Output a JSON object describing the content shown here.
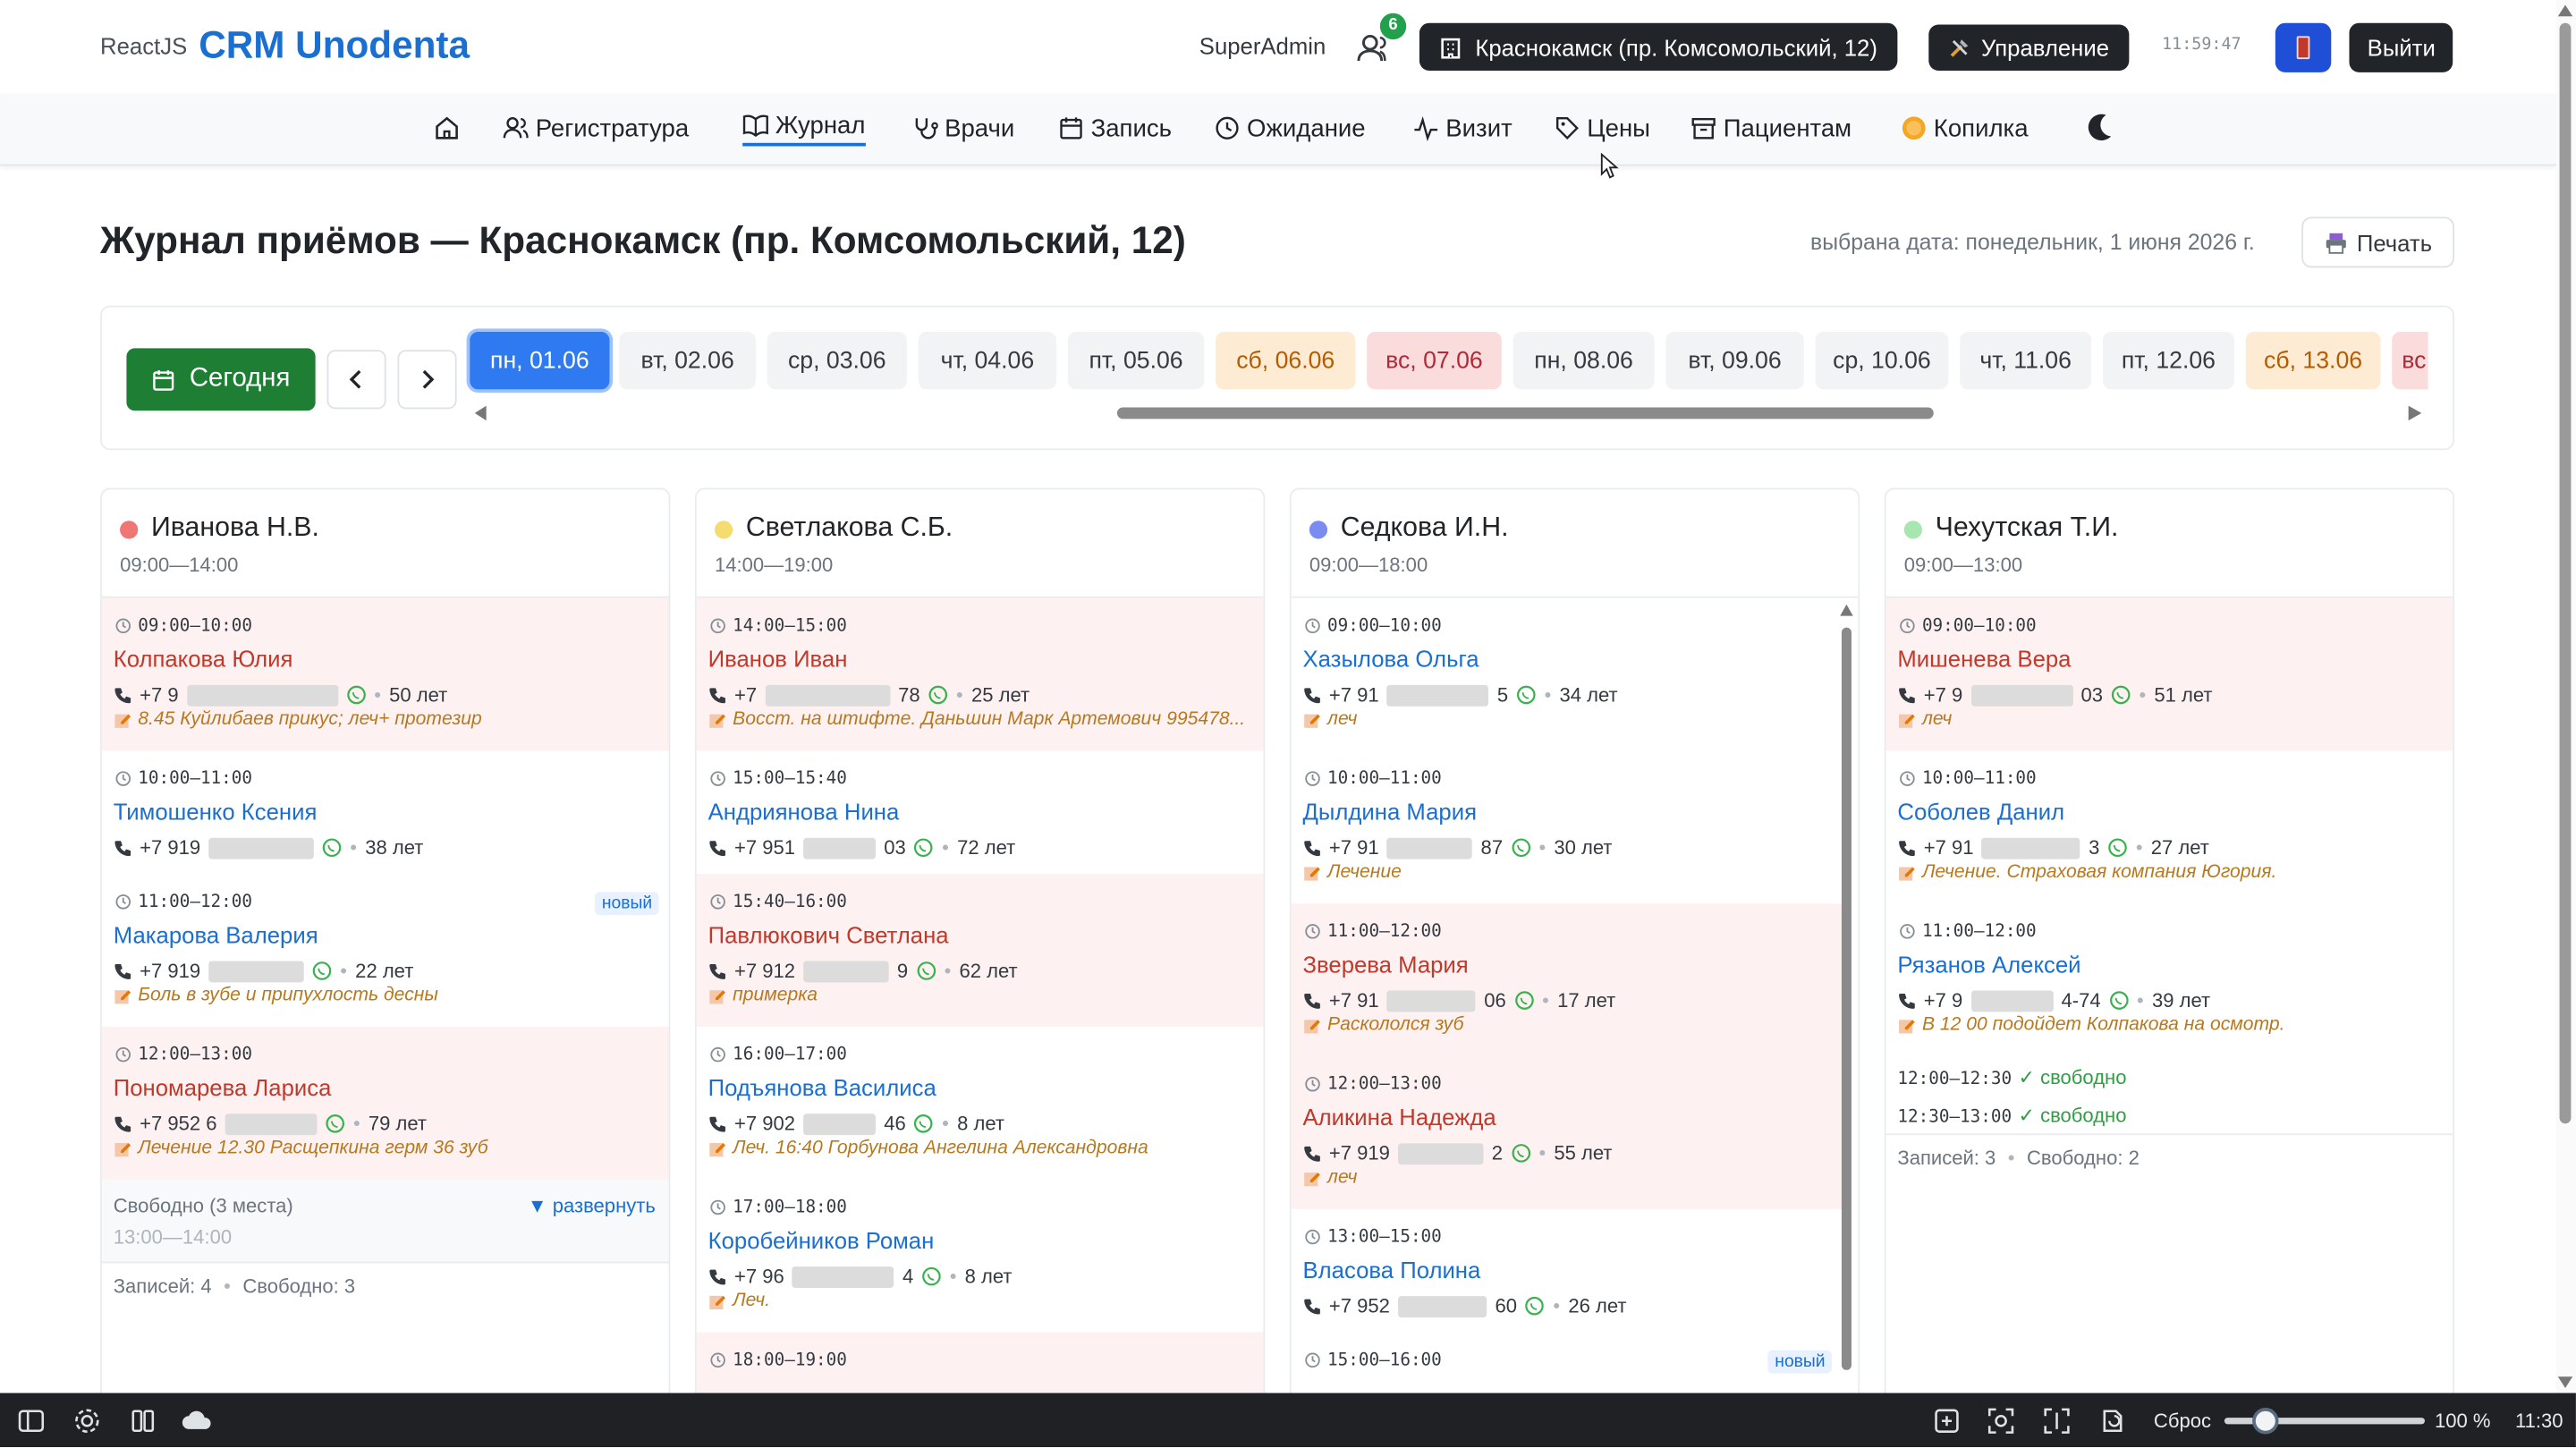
{
  "header": {
    "brand_small": "ReactJS",
    "brand_big": "CRM Unodenta",
    "user": "SuperAdmin",
    "users_count": "6",
    "branch_button": "Краснокамск (пр. Комсомольский, 12)",
    "manage_button": "Управление",
    "clock": "11:59:47",
    "logout_button": "Выйти"
  },
  "nav": {
    "registry": "Регистратура",
    "journal": "Журнал",
    "doctors": "Врачи",
    "record": "Запись",
    "waiting": "Ожидание",
    "visit": "Визит",
    "prices": "Цены",
    "patients": "Пациентам",
    "piggy": "Копилка"
  },
  "page": {
    "title": "Журнал приёмов — Краснокамск (пр. Комсомольский, 12)",
    "selected_date": "выбрана дата: понедельник, 1 июня 2026 г.",
    "print_button": "Печать"
  },
  "dates": {
    "today_button": "Сегодня",
    "days": [
      "пн, 01.06",
      "вт, 02.06",
      "ср, 03.06",
      "чт, 04.06",
      "пт, 05.06",
      "сб, 06.06",
      "вс, 07.06",
      "пн, 08.06",
      "вт, 09.06",
      "ср, 10.06",
      "чт, 11.06",
      "пт, 12.06",
      "сб, 13.06",
      "вс"
    ]
  },
  "columns": [
    {
      "doctor": "Иванова Н.В.",
      "hours": "09:00—14:00",
      "color": "#f07575",
      "appointments": [
        {
          "time": "09:00—10:00",
          "name": "Колпакова Юлия",
          "phone_pre": "+7 9",
          "phone_post": "",
          "age": "50 лет",
          "note": "8.45 Куйлибаев прикус; леч+ протезир"
        },
        {
          "time": "10:00—11:00",
          "name": "Тимошенко Ксения",
          "phone_pre": "+7 919",
          "phone_post": "",
          "age": "38 лет",
          "note": ""
        },
        {
          "time": "11:00—12:00",
          "name": "Макарова Валерия",
          "phone_pre": "+7 919",
          "phone_post": "",
          "age": "22 лет",
          "note": "Боль в зубе и припухлость десны",
          "badge": "новый"
        },
        {
          "time": "12:00—13:00",
          "name": "Пономарева Лариса",
          "phone_pre": "+7 952 6",
          "phone_post": "",
          "age": "79 лет",
          "note": "Лечение 12.30 Расщепкина герм 36 зуб"
        }
      ],
      "free_summary": "Свободно (3 места)",
      "free_range": "13:00—14:00",
      "expand": "▼ развернуть",
      "stat_records": "Записей: 4",
      "stat_free": "Свободно: 3"
    },
    {
      "doctor": "Светлакова С.Б.",
      "hours": "14:00—19:00",
      "color": "#f5dc6e",
      "appointments": [
        {
          "time": "14:00—15:00",
          "name": "Иванов Иван",
          "phone_pre": "+7",
          "phone_post": "78",
          "age": "25 лет",
          "note": "Восст. на штифте. Даньшин Марк Артемович 995478..."
        },
        {
          "time": "15:00—15:40",
          "name": "Андриянова Нина",
          "phone_pre": "+7 951",
          "phone_post": "03",
          "age": "72 лет",
          "note": ""
        },
        {
          "time": "15:40—16:00",
          "name": "Павлюкович Светлана",
          "phone_pre": "+7 912",
          "phone_post": "9",
          "age": "62 лет",
          "note": "примерка"
        },
        {
          "time": "16:00—17:00",
          "name": "Подъянова Василиса",
          "phone_pre": "+7 902",
          "phone_post": "46",
          "age": "8 лет",
          "note": "Леч. 16:40 Горбунова Ангелина Александровна"
        },
        {
          "time": "17:00—18:00",
          "name": "Коробейников Роман",
          "phone_pre": "+7 96",
          "phone_post": "4",
          "age": "8 лет",
          "note": "Леч."
        },
        {
          "time": "18:00—19:00"
        }
      ]
    },
    {
      "doctor": "Седкова И.Н.",
      "hours": "09:00—18:00",
      "color": "#7b8cf0",
      "appointments": [
        {
          "time": "09:00—10:00",
          "name": "Хазылова Ольга",
          "phone_pre": "+7 91",
          "phone_post": "5",
          "age": "34 лет",
          "note": "леч"
        },
        {
          "time": "10:00—11:00",
          "name": "Дылдина Мария",
          "phone_pre": "+7 91",
          "phone_post": "87",
          "age": "30 лет",
          "note": "Лечение"
        },
        {
          "time": "11:00—12:00",
          "name": "Зверева Мария",
          "phone_pre": "+7 91",
          "phone_post": "06",
          "age": "17 лет",
          "note": "Раскололся зуб"
        },
        {
          "time": "12:00—13:00",
          "name": "Аликина Надежда",
          "phone_pre": "+7 919",
          "phone_post": "2",
          "age": "55 лет",
          "note": "леч"
        },
        {
          "time": "13:00—15:00",
          "name": "Власова Полина",
          "phone_pre": "+7 952",
          "phone_post": "60",
          "age": "26 лет",
          "note": ""
        },
        {
          "time": "15:00—16:00",
          "badge": "новый"
        }
      ]
    },
    {
      "doctor": "Чехутская Т.И.",
      "hours": "09:00—13:00",
      "color": "#a8e6b0",
      "appointments": [
        {
          "time": "09:00—10:00",
          "name": "Мишенева Вера",
          "phone_pre": "+7 9",
          "phone_post": "03",
          "age": "51 лет",
          "note": "леч"
        },
        {
          "time": "10:00—11:00",
          "name": "Соболев Данил",
          "phone_pre": "+7 91",
          "phone_post": "3",
          "age": "27 лет",
          "note": "Лечение. Страховая компания Югория."
        },
        {
          "time": "11:00—12:00",
          "name": "Рязанов Алексей",
          "phone_pre": "+7 9",
          "phone_post": "4-74",
          "age": "39 лет",
          "note": "В 12 00 подойдет Колпакова на осмотр."
        }
      ],
      "free_slots": [
        {
          "time": "12:00—12:30",
          "label": "✓ свободно"
        },
        {
          "time": "12:30—13:00",
          "label": "✓ свободно"
        }
      ],
      "stat_records": "Записей: 3",
      "stat_free": "Свободно: 2"
    }
  ],
  "taskbar": {
    "reset": "Сброс",
    "zoom": "100 %",
    "time": "11:30"
  }
}
